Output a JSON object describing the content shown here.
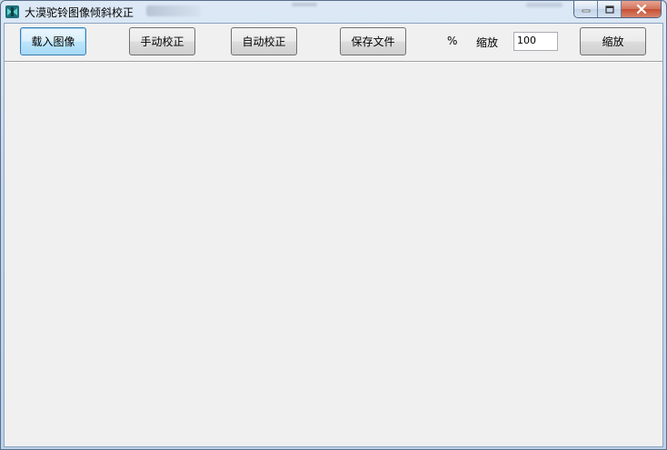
{
  "window": {
    "title": "大漠驼铃图像倾斜校正"
  },
  "toolbar": {
    "load_label": "载入图像",
    "manual_label": "手动校正",
    "auto_label": "自动校正",
    "save_label": "保存文件",
    "percent_label": "%",
    "zoom_label": "缩放",
    "zoom_value": "100",
    "zoom_button_label": "缩放"
  },
  "colors": {
    "client_bg": "#f0f0f0",
    "close_button": "#c54f33",
    "titlebar": "#c3d6ec"
  }
}
